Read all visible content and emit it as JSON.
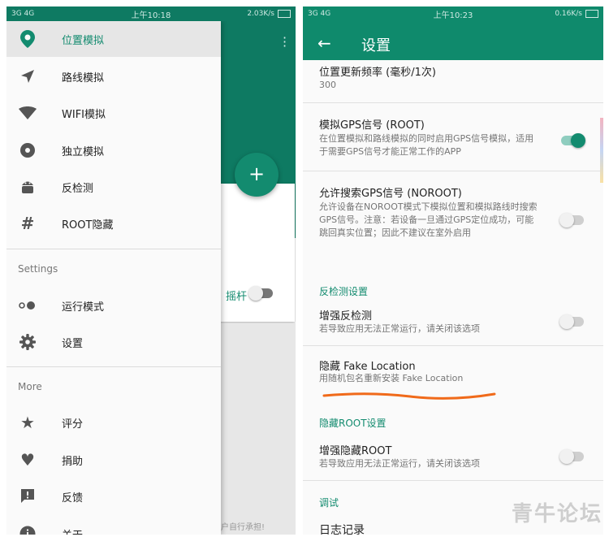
{
  "left_phone": {
    "status": {
      "network": "3G  4G",
      "time": "上午10:18",
      "speed": "2.03K/s"
    },
    "background": {
      "fab_label": "+",
      "rocker_label": "摇杆",
      "bottom_text": "户自行承担!"
    },
    "drawer": {
      "items": [
        {
          "label": "位置模拟",
          "icon": "location-pin-icon"
        },
        {
          "label": "路线模拟",
          "icon": "navigation-arrow-icon"
        },
        {
          "label": "WIFI模拟",
          "icon": "wifi-icon"
        },
        {
          "label": "独立模拟",
          "icon": "record-icon"
        },
        {
          "label": "反检测",
          "icon": "android-icon"
        },
        {
          "label": "ROOT隐藏",
          "icon": "hash-icon"
        }
      ],
      "settings_header": "Settings",
      "settings_items": [
        {
          "label": "运行模式",
          "icon": "toggle-dots-icon"
        },
        {
          "label": "设置",
          "icon": "gear-icon"
        }
      ],
      "more_header": "More",
      "more_items": [
        {
          "label": "评分",
          "icon": "star-icon"
        },
        {
          "label": "捐助",
          "icon": "heart-icon"
        },
        {
          "label": "反馈",
          "icon": "feedback-icon"
        },
        {
          "label": "关于",
          "icon": "info-icon"
        }
      ]
    }
  },
  "right_phone": {
    "status": {
      "network": "3G  4G",
      "time": "上午10:23",
      "speed": "0.16K/s"
    },
    "appbar": {
      "title": "设置"
    },
    "prefs": {
      "update_freq": {
        "title": "位置更新频率 (毫秒/1次)",
        "value": "300"
      },
      "gps_signal": {
        "title": "模拟GPS信号 (ROOT)",
        "summary": "在位置模拟和路线模拟的同时启用GPS信号模拟，适用于需要GPS信号才能正常工作的APP",
        "on": true
      },
      "gps_search": {
        "title": "允许搜索GPS信号 (NOROOT)",
        "summary": "允许设备在NOROOT模式下模拟位置和模拟路线时搜索GPS信号。注意：若设备一旦通过GPS定位成功，可能跳回真实位置；因此不建议在室外启用",
        "on": false
      },
      "cat_anti_detect": "反检测设置",
      "enhance_anti": {
        "title": "增强反检测",
        "summary": "若导致应用无法正常运行，请关闭该选项",
        "on": false
      },
      "hide_fake": {
        "title": "隐藏 Fake Location",
        "summary": "用随机包名重新安装 Fake Location"
      },
      "cat_hide_root": "隐藏ROOT设置",
      "enhance_root": {
        "title": "增强隐藏ROOT",
        "summary": "若导致应用无法正常运行，请关闭该选项",
        "on": false
      },
      "cat_debug": "调试",
      "log": {
        "title": "日志记录"
      }
    }
  },
  "colors": {
    "accent": "#138b6f",
    "appbar": "#0f8a6c",
    "annotation": "#f06a1a"
  },
  "watermark": "青牛论坛"
}
